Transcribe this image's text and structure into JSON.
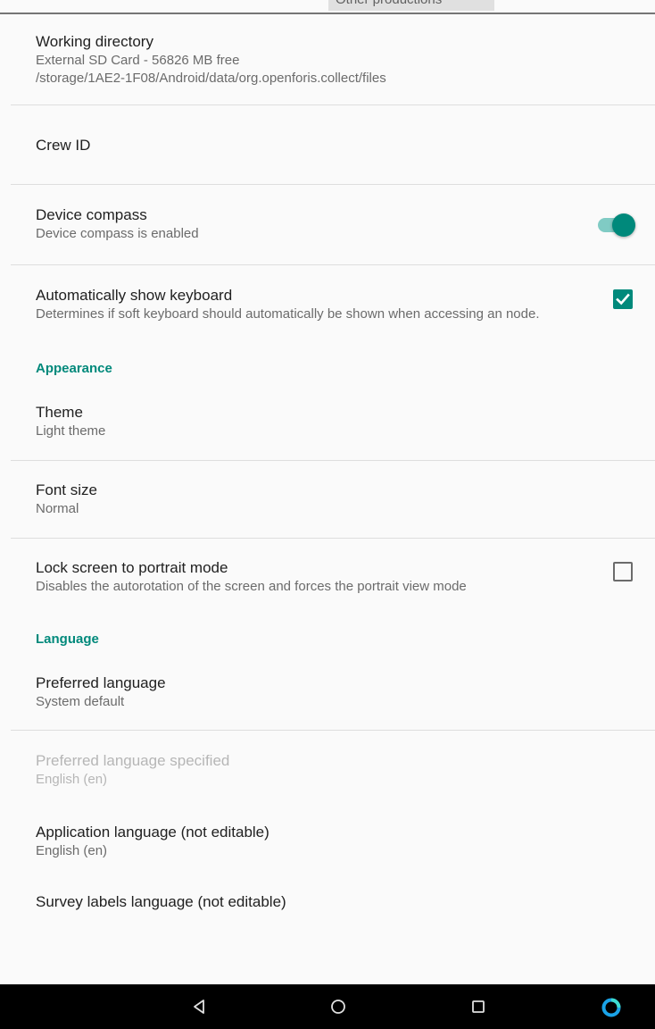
{
  "topbar": {
    "cutoff_label": "Other productions"
  },
  "general": {
    "working_directory": {
      "title": "Working directory",
      "summary_line1": "External SD Card - 56826 MB free",
      "summary_line2": "/storage/1AE2-1F08/Android/data/org.openforis.collect/files"
    },
    "crew_id": {
      "title": "Crew ID"
    },
    "device_compass": {
      "title": "Device compass",
      "summary": "Device compass is enabled",
      "enabled": true
    },
    "auto_keyboard": {
      "title": "Automatically show keyboard",
      "summary": "Determines if soft keyboard should automatically be shown when accessing an node.",
      "checked": true
    }
  },
  "appearance": {
    "header": "Appearance",
    "theme": {
      "title": "Theme",
      "summary": "Light theme"
    },
    "font_size": {
      "title": "Font size",
      "summary": "Normal"
    },
    "lock_portrait": {
      "title": "Lock screen to portrait mode",
      "summary": "Disables the autorotation of the screen and forces the portrait view mode",
      "checked": false
    }
  },
  "language": {
    "header": "Language",
    "preferred": {
      "title": "Preferred language",
      "summary": "System default"
    },
    "preferred_specified": {
      "title": "Preferred language specified",
      "summary": "English (en)",
      "enabled": false
    },
    "application": {
      "title": "Application language (not editable)",
      "summary": "English (en)"
    },
    "survey_labels": {
      "title": "Survey labels language (not editable)"
    }
  },
  "navbar": {
    "icons": [
      "back-icon",
      "home-icon",
      "recents-icon",
      "assistant-icon"
    ]
  },
  "colors": {
    "accent": "#00897b",
    "accent_light": "#80cbc4",
    "background": "#fafafa",
    "divider": "#dedede"
  }
}
